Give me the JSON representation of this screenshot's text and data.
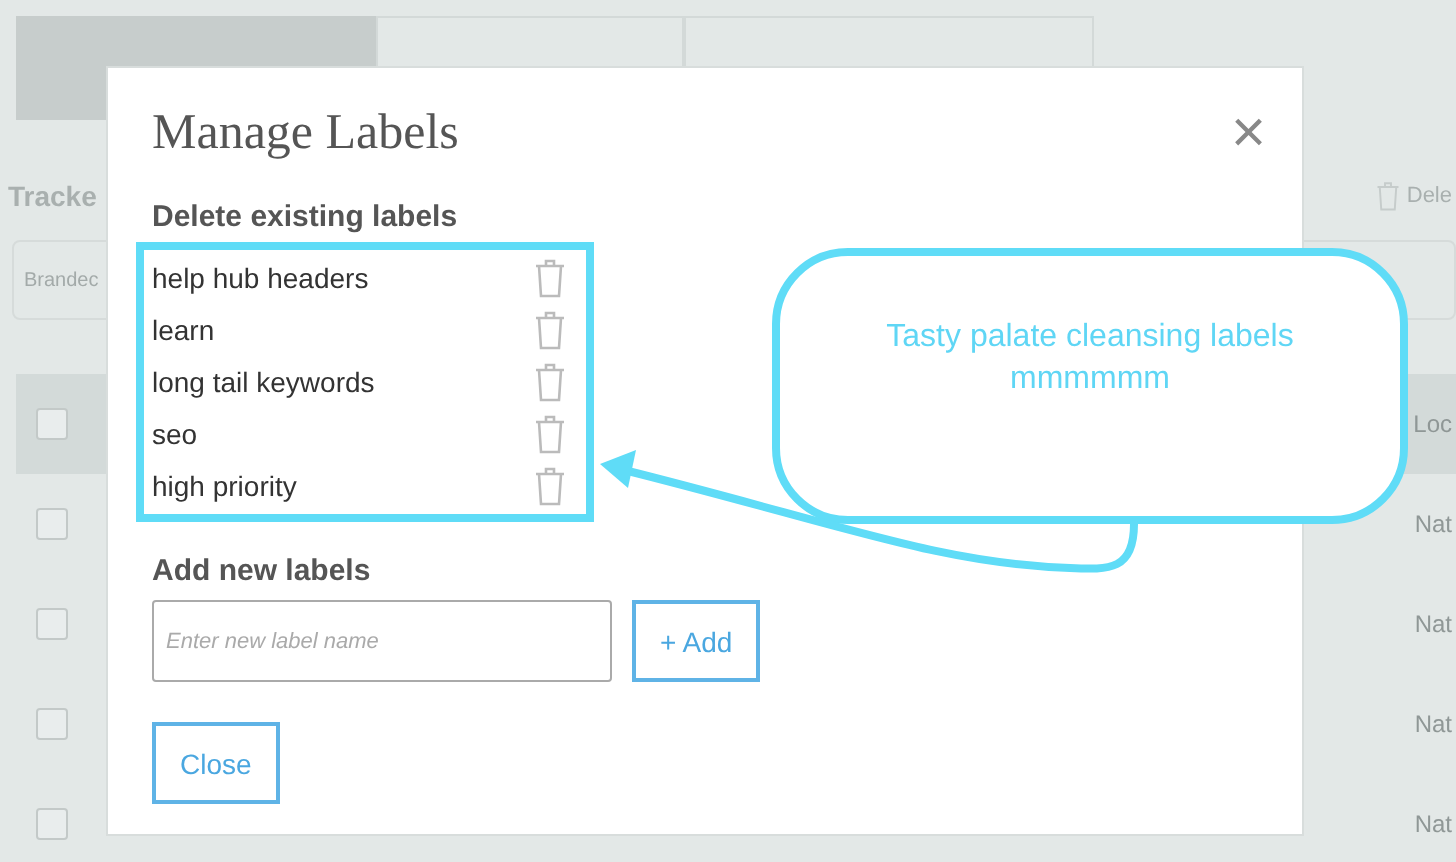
{
  "background": {
    "tabs": [
      {
        "selected": true
      },
      {
        "selected": false
      },
      {
        "selected": false
      }
    ],
    "heading": "Tracke",
    "delete_action": "Dele",
    "filter": "Brandec",
    "rows": [
      {
        "column_2": "Loc",
        "highlighted": true
      },
      {
        "column_2": "Nat",
        "highlighted": false
      },
      {
        "column_2": "Nat",
        "highlighted": false
      },
      {
        "column_2": "Nat",
        "highlighted": false
      },
      {
        "column_2": "Nat",
        "highlighted": false
      }
    ]
  },
  "dialog": {
    "title": "Manage Labels",
    "close_icon": "×",
    "delete_heading": "Delete existing labels",
    "labels": [
      "help hub headers",
      "learn",
      "long tail keywords",
      "seo",
      "high priority"
    ],
    "add_heading": "Add new labels",
    "input": {
      "placeholder": "Enter new label name"
    },
    "add_button": "+ Add",
    "close_button": "Close"
  },
  "annotation": {
    "text": "Tasty palate cleansing labels mmmmmm"
  }
}
